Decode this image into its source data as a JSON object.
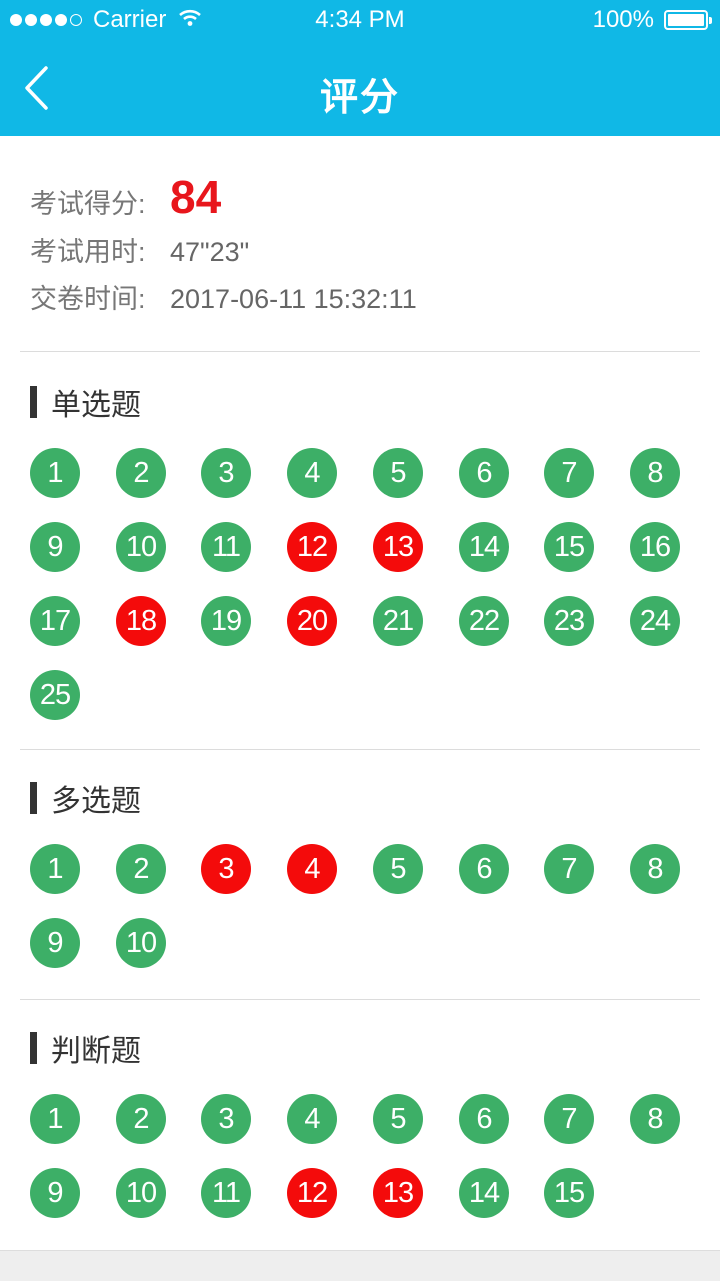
{
  "status": {
    "carrier": "Carrier",
    "time": "4:34 PM",
    "battery": "100%"
  },
  "nav": {
    "title": "评分"
  },
  "summary": {
    "score_label": "考试得分:",
    "score": "84",
    "duration_label": "考试用时:",
    "duration": "47\"23\"",
    "submit_label": "交卷时间:",
    "submit_time": "2017-06-11 15:32:11"
  },
  "colors": {
    "correct": "#3daf67",
    "wrong": "#f40b0b",
    "accent": "#10b8e6",
    "score": "#e8161c"
  },
  "sections": [
    {
      "title": "单选题",
      "questions": [
        {
          "n": "1",
          "s": "correct"
        },
        {
          "n": "2",
          "s": "correct"
        },
        {
          "n": "3",
          "s": "correct"
        },
        {
          "n": "4",
          "s": "correct"
        },
        {
          "n": "5",
          "s": "correct"
        },
        {
          "n": "6",
          "s": "correct"
        },
        {
          "n": "7",
          "s": "correct"
        },
        {
          "n": "8",
          "s": "correct"
        },
        {
          "n": "9",
          "s": "correct"
        },
        {
          "n": "10",
          "s": "correct"
        },
        {
          "n": "11",
          "s": "correct"
        },
        {
          "n": "12",
          "s": "wrong"
        },
        {
          "n": "13",
          "s": "wrong"
        },
        {
          "n": "14",
          "s": "correct"
        },
        {
          "n": "15",
          "s": "correct"
        },
        {
          "n": "16",
          "s": "correct"
        },
        {
          "n": "17",
          "s": "correct"
        },
        {
          "n": "18",
          "s": "wrong"
        },
        {
          "n": "19",
          "s": "correct"
        },
        {
          "n": "20",
          "s": "wrong"
        },
        {
          "n": "21",
          "s": "correct"
        },
        {
          "n": "22",
          "s": "correct"
        },
        {
          "n": "23",
          "s": "correct"
        },
        {
          "n": "24",
          "s": "correct"
        },
        {
          "n": "25",
          "s": "correct"
        }
      ]
    },
    {
      "title": "多选题",
      "questions": [
        {
          "n": "1",
          "s": "correct"
        },
        {
          "n": "2",
          "s": "correct"
        },
        {
          "n": "3",
          "s": "wrong"
        },
        {
          "n": "4",
          "s": "wrong"
        },
        {
          "n": "5",
          "s": "correct"
        },
        {
          "n": "6",
          "s": "correct"
        },
        {
          "n": "7",
          "s": "correct"
        },
        {
          "n": "8",
          "s": "correct"
        },
        {
          "n": "9",
          "s": "correct"
        },
        {
          "n": "10",
          "s": "correct"
        }
      ]
    },
    {
      "title": "判断题",
      "questions": [
        {
          "n": "1",
          "s": "correct"
        },
        {
          "n": "2",
          "s": "correct"
        },
        {
          "n": "3",
          "s": "correct"
        },
        {
          "n": "4",
          "s": "correct"
        },
        {
          "n": "5",
          "s": "correct"
        },
        {
          "n": "6",
          "s": "correct"
        },
        {
          "n": "7",
          "s": "correct"
        },
        {
          "n": "8",
          "s": "correct"
        },
        {
          "n": "9",
          "s": "correct"
        },
        {
          "n": "10",
          "s": "correct"
        },
        {
          "n": "11",
          "s": "correct"
        },
        {
          "n": "12",
          "s": "wrong"
        },
        {
          "n": "13",
          "s": "wrong"
        },
        {
          "n": "14",
          "s": "correct"
        },
        {
          "n": "15",
          "s": "correct"
        }
      ]
    }
  ]
}
